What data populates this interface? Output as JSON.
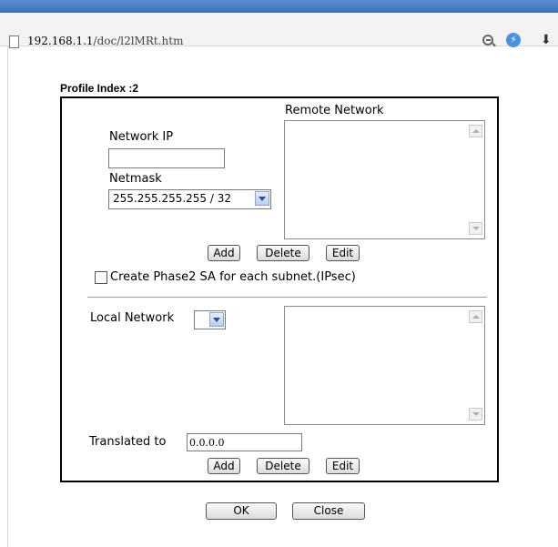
{
  "browser": {
    "url_host": "192.168.1.1",
    "url_path": "/doc/l2lMRt.htm"
  },
  "profile": {
    "label": "Profile Index :2"
  },
  "remote": {
    "title": "Remote Network",
    "network_ip_label": "Network IP",
    "network_ip_value": "",
    "netmask_label": "Netmask",
    "netmask_value": "255.255.255.255 / 32",
    "add_label": "Add",
    "delete_label": "Delete",
    "edit_label": "Edit"
  },
  "phase2": {
    "label": "Create Phase2 SA for each subnet.(IPsec)",
    "checked": false
  },
  "local": {
    "label": "Local Network",
    "select_value": "",
    "translated_label": "Translated to",
    "translated_value": "0.0.0.0",
    "add_label": "Add",
    "delete_label": "Delete",
    "edit_label": "Edit"
  },
  "footer": {
    "ok_label": "OK",
    "close_label": "Close"
  }
}
